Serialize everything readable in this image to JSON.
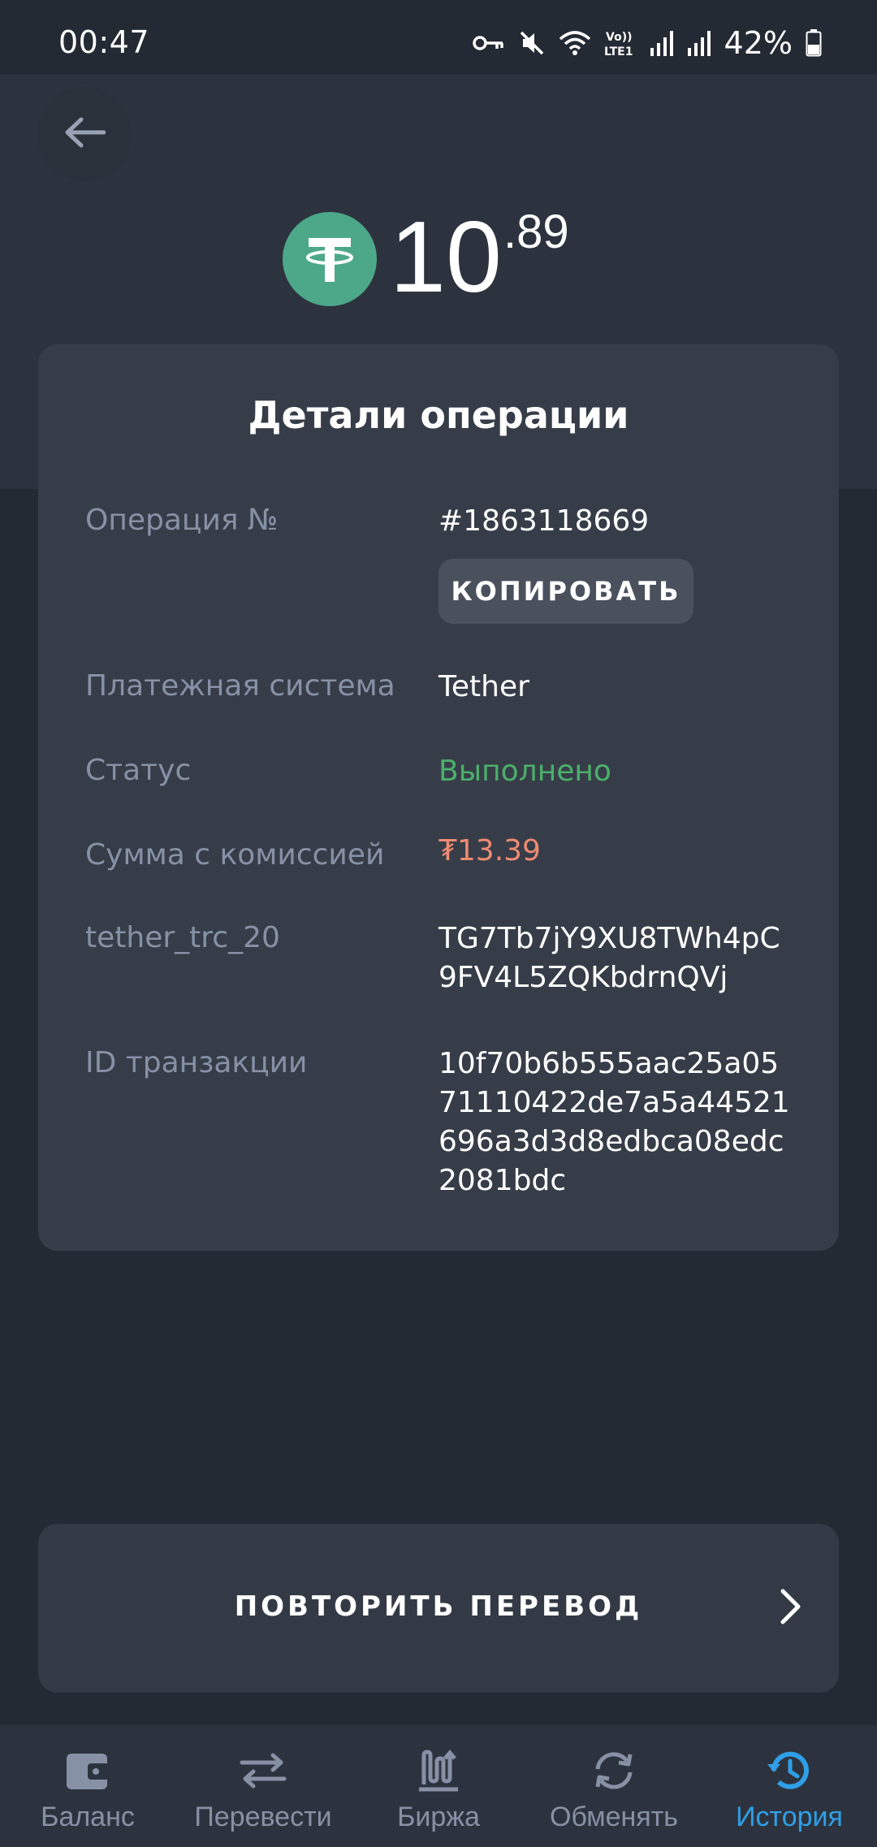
{
  "status_bar": {
    "time": "00:47",
    "battery": "42%",
    "icons": [
      "key-icon",
      "mute-icon",
      "wifi-icon",
      "volte-icon",
      "signal-icon",
      "signal-icon",
      "battery-icon"
    ]
  },
  "amount": {
    "currency_icon": "tether-icon",
    "integer": "10",
    "decimal": ".89"
  },
  "details": {
    "title": "Детали операции",
    "operation_label": "Операция №",
    "operation_value": "#1863118669",
    "copy_label": "КОПИРОВАТЬ",
    "payment_system_label": "Платежная система",
    "payment_system_value": "Tether",
    "status_label": "Статус",
    "status_value": "Выполнено",
    "sum_label": "Сумма с комиссией",
    "sum_value": "₮13.39",
    "wallet_label": "tether_trc_20",
    "wallet_value": "TG7Tb7jY9XU8TWh4pC9FV4L5ZQKbdrnQVj",
    "tx_label": "ID транзакции",
    "tx_value": "10f70b6b555aac25a0571110422de7a5a44521696a3d3d8edbca08edc2081bdc"
  },
  "repeat_button": {
    "label": "ПОВТОРИТЬ ПЕРЕВОД"
  },
  "nav": {
    "items": [
      {
        "label": "Баланс",
        "icon": "wallet-icon"
      },
      {
        "label": "Перевести",
        "icon": "transfer-icon"
      },
      {
        "label": "Биржа",
        "icon": "exchange-chart-icon"
      },
      {
        "label": "Обменять",
        "icon": "swap-icon"
      },
      {
        "label": "История",
        "icon": "history-icon"
      }
    ],
    "active_index": 4
  },
  "colors": {
    "status_success": "#4caf6a",
    "sum_accent": "#ef8a72",
    "nav_active": "#2f9fe8",
    "tether_green": "#4ca889"
  }
}
